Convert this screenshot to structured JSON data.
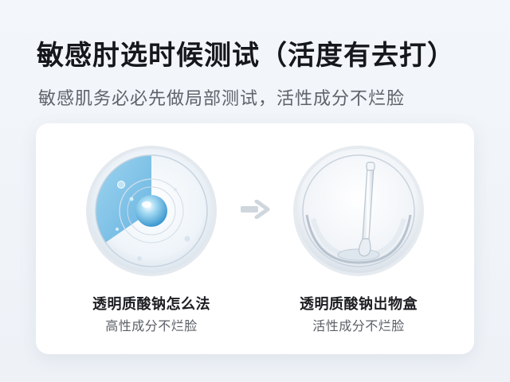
{
  "header": {
    "title": "敏感肘选时候测试（活度有去打）",
    "subtitle": "敏感肌务必必先做局部测试，活性成分不烂脸"
  },
  "products": [
    {
      "name": "透明质酸钠怎么法",
      "subtitle": "高性成分不烂脸"
    },
    {
      "name": "透明质酸钠岀物盒",
      "subtitle": "活性成分不烂脸"
    }
  ],
  "colors": {
    "accent_blue": "#7cc3e6",
    "title_text": "#15171c",
    "subtitle_text": "#5e636b"
  },
  "icons": {
    "arrow": "chevron-right-arrow-icon"
  }
}
